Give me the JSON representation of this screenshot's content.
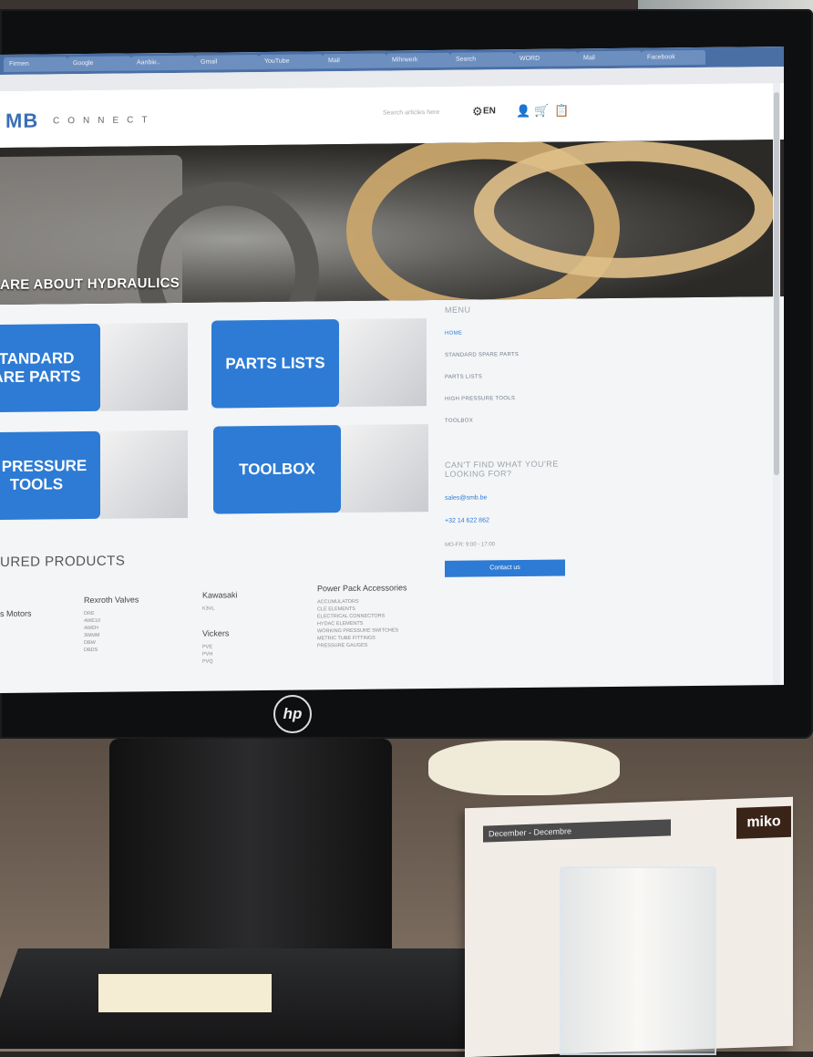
{
  "browser": {
    "tabs": [
      "Firmen",
      "Google",
      "Aanbie..",
      "Gmail",
      "YouTube",
      "Mail",
      "Mihrwerk",
      "Search",
      "WORD",
      "Mail",
      "Facebook"
    ]
  },
  "site": {
    "logo": "MB",
    "logo_suffix": "CONNECT",
    "search_placeholder": "Search articles here",
    "language": "EN",
    "hero_text": "ARE ABOUT HYDRAULICS",
    "tiles": [
      {
        "label": "STANDARD SPARE PARTS"
      },
      {
        "label": "PARTS LISTS"
      },
      {
        "label": "HIGH PRESSURE TOOLS"
      },
      {
        "label": "TOOLBOX"
      }
    ],
    "tile_display": [
      "TANDARD\nARE PARTS",
      "PARTS LISTS",
      "H PRESSURE\nTOOLS",
      "TOOLBOX"
    ],
    "sidebar": {
      "heading": "MENU",
      "items": [
        "HOME",
        "STANDARD SPARE PARTS",
        "PARTS LISTS",
        "HIGH PRESSURE TOOLS",
        "TOOLBOX"
      ],
      "cant_find": "CAN'T FIND WHAT YOU'RE LOOKING FOR?",
      "email": "sales@smb.be",
      "phone": "+32 14 622 862",
      "hours": "MO-FR: 9:00 - 17:00",
      "contact_button": "Contact us"
    },
    "featured_title": "URED PRODUCTS",
    "columns": [
      {
        "header": "s Motors",
        "items": []
      },
      {
        "header": "Rexroth Valves",
        "items": [
          "DRE",
          "4WE10",
          "4WEH",
          "3WMM",
          "DBW",
          "DBDS",
          "ZDC"
        ]
      },
      {
        "header": "Kawasaki",
        "items": [
          "K3VL"
        ]
      },
      {
        "header": "Vickers",
        "items": [
          "PVE",
          "PVH",
          "PVQ"
        ]
      },
      {
        "header": "Power Pack Accessories",
        "items": [
          "ACCUMULATORS",
          "CLE ELEMENTS",
          "ELECTRICAL CONNECTORS",
          "HYDAC ELEMENTS",
          "WORKING PRESSURE SWITCHES",
          "METRIC TUBE FITTINGS",
          "PRESSURE GAUGES"
        ]
      }
    ]
  },
  "monitor": {
    "brand": "hp"
  },
  "desk": {
    "calendar_header": "December - Decembre",
    "miko": "miko"
  }
}
